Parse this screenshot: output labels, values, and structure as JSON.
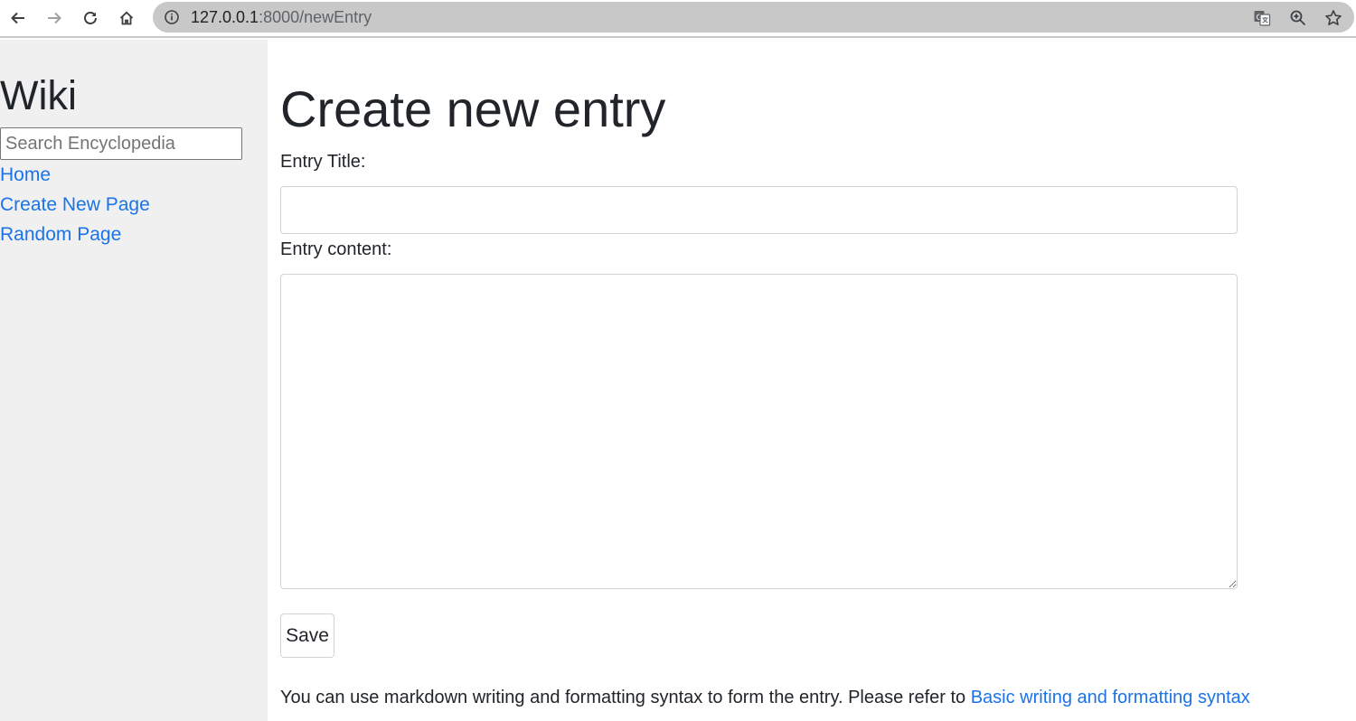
{
  "browser": {
    "url_host": "127.0.0.1",
    "url_rest": ":8000/newEntry",
    "icons": [
      "back-icon",
      "forward-icon",
      "reload-icon",
      "home-icon",
      "info-icon",
      "translate-icon",
      "zoom-icon",
      "bookmark-star-icon"
    ]
  },
  "sidebar": {
    "title": "Wiki",
    "search_placeholder": "Search Encyclopedia",
    "links": [
      {
        "label": "Home"
      },
      {
        "label": "Create New Page"
      },
      {
        "label": "Random Page"
      }
    ]
  },
  "main": {
    "title": "Create new entry",
    "title_label": "Entry Title:",
    "title_value": "",
    "content_label": "Entry content:",
    "content_value": "",
    "save_label": "Save",
    "hint_text": "You can use markdown writing and formatting syntax to form the entry. Please refer to ",
    "hint_link": "Basic writing and formatting syntax"
  },
  "colors": {
    "link": "#1a73e8",
    "sidebar_bg": "#f0f0f0",
    "omnibox_bg": "#c8c8c8",
    "text": "#212529"
  }
}
